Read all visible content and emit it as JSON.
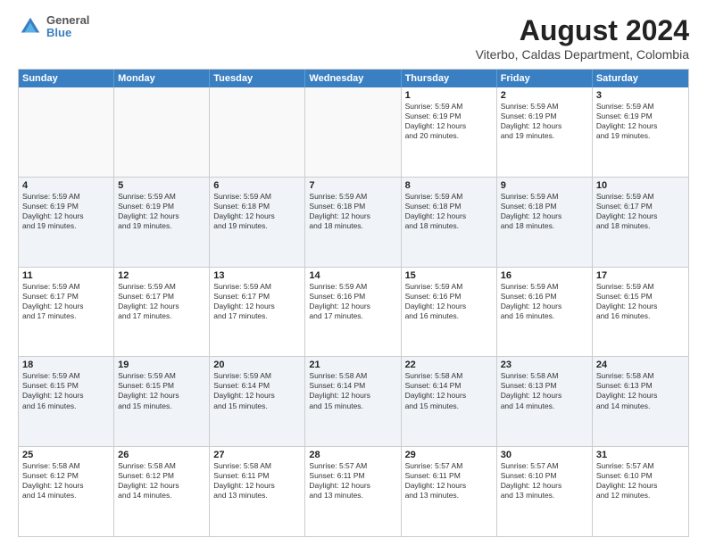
{
  "header": {
    "logo_line1": "General",
    "logo_line2": "Blue",
    "title": "August 2024",
    "subtitle": "Viterbo, Caldas Department, Colombia"
  },
  "days_of_week": [
    "Sunday",
    "Monday",
    "Tuesday",
    "Wednesday",
    "Thursday",
    "Friday",
    "Saturday"
  ],
  "weeks": [
    [
      {
        "day": "",
        "text": "",
        "empty": true
      },
      {
        "day": "",
        "text": "",
        "empty": true
      },
      {
        "day": "",
        "text": "",
        "empty": true
      },
      {
        "day": "",
        "text": "",
        "empty": true
      },
      {
        "day": "1",
        "text": "Sunrise: 5:59 AM\nSunset: 6:19 PM\nDaylight: 12 hours\nand 20 minutes."
      },
      {
        "day": "2",
        "text": "Sunrise: 5:59 AM\nSunset: 6:19 PM\nDaylight: 12 hours\nand 19 minutes."
      },
      {
        "day": "3",
        "text": "Sunrise: 5:59 AM\nSunset: 6:19 PM\nDaylight: 12 hours\nand 19 minutes."
      }
    ],
    [
      {
        "day": "4",
        "text": "Sunrise: 5:59 AM\nSunset: 6:19 PM\nDaylight: 12 hours\nand 19 minutes.",
        "shaded": true
      },
      {
        "day": "5",
        "text": "Sunrise: 5:59 AM\nSunset: 6:19 PM\nDaylight: 12 hours\nand 19 minutes.",
        "shaded": true
      },
      {
        "day": "6",
        "text": "Sunrise: 5:59 AM\nSunset: 6:18 PM\nDaylight: 12 hours\nand 19 minutes.",
        "shaded": true
      },
      {
        "day": "7",
        "text": "Sunrise: 5:59 AM\nSunset: 6:18 PM\nDaylight: 12 hours\nand 18 minutes.",
        "shaded": true
      },
      {
        "day": "8",
        "text": "Sunrise: 5:59 AM\nSunset: 6:18 PM\nDaylight: 12 hours\nand 18 minutes.",
        "shaded": true
      },
      {
        "day": "9",
        "text": "Sunrise: 5:59 AM\nSunset: 6:18 PM\nDaylight: 12 hours\nand 18 minutes.",
        "shaded": true
      },
      {
        "day": "10",
        "text": "Sunrise: 5:59 AM\nSunset: 6:17 PM\nDaylight: 12 hours\nand 18 minutes.",
        "shaded": true
      }
    ],
    [
      {
        "day": "11",
        "text": "Sunrise: 5:59 AM\nSunset: 6:17 PM\nDaylight: 12 hours\nand 17 minutes."
      },
      {
        "day": "12",
        "text": "Sunrise: 5:59 AM\nSunset: 6:17 PM\nDaylight: 12 hours\nand 17 minutes."
      },
      {
        "day": "13",
        "text": "Sunrise: 5:59 AM\nSunset: 6:17 PM\nDaylight: 12 hours\nand 17 minutes."
      },
      {
        "day": "14",
        "text": "Sunrise: 5:59 AM\nSunset: 6:16 PM\nDaylight: 12 hours\nand 17 minutes."
      },
      {
        "day": "15",
        "text": "Sunrise: 5:59 AM\nSunset: 6:16 PM\nDaylight: 12 hours\nand 16 minutes."
      },
      {
        "day": "16",
        "text": "Sunrise: 5:59 AM\nSunset: 6:16 PM\nDaylight: 12 hours\nand 16 minutes."
      },
      {
        "day": "17",
        "text": "Sunrise: 5:59 AM\nSunset: 6:15 PM\nDaylight: 12 hours\nand 16 minutes."
      }
    ],
    [
      {
        "day": "18",
        "text": "Sunrise: 5:59 AM\nSunset: 6:15 PM\nDaylight: 12 hours\nand 16 minutes.",
        "shaded": true
      },
      {
        "day": "19",
        "text": "Sunrise: 5:59 AM\nSunset: 6:15 PM\nDaylight: 12 hours\nand 15 minutes.",
        "shaded": true
      },
      {
        "day": "20",
        "text": "Sunrise: 5:59 AM\nSunset: 6:14 PM\nDaylight: 12 hours\nand 15 minutes.",
        "shaded": true
      },
      {
        "day": "21",
        "text": "Sunrise: 5:58 AM\nSunset: 6:14 PM\nDaylight: 12 hours\nand 15 minutes.",
        "shaded": true
      },
      {
        "day": "22",
        "text": "Sunrise: 5:58 AM\nSunset: 6:14 PM\nDaylight: 12 hours\nand 15 minutes.",
        "shaded": true
      },
      {
        "day": "23",
        "text": "Sunrise: 5:58 AM\nSunset: 6:13 PM\nDaylight: 12 hours\nand 14 minutes.",
        "shaded": true
      },
      {
        "day": "24",
        "text": "Sunrise: 5:58 AM\nSunset: 6:13 PM\nDaylight: 12 hours\nand 14 minutes.",
        "shaded": true
      }
    ],
    [
      {
        "day": "25",
        "text": "Sunrise: 5:58 AM\nSunset: 6:12 PM\nDaylight: 12 hours\nand 14 minutes."
      },
      {
        "day": "26",
        "text": "Sunrise: 5:58 AM\nSunset: 6:12 PM\nDaylight: 12 hours\nand 14 minutes."
      },
      {
        "day": "27",
        "text": "Sunrise: 5:58 AM\nSunset: 6:11 PM\nDaylight: 12 hours\nand 13 minutes."
      },
      {
        "day": "28",
        "text": "Sunrise: 5:57 AM\nSunset: 6:11 PM\nDaylight: 12 hours\nand 13 minutes."
      },
      {
        "day": "29",
        "text": "Sunrise: 5:57 AM\nSunset: 6:11 PM\nDaylight: 12 hours\nand 13 minutes."
      },
      {
        "day": "30",
        "text": "Sunrise: 5:57 AM\nSunset: 6:10 PM\nDaylight: 12 hours\nand 13 minutes."
      },
      {
        "day": "31",
        "text": "Sunrise: 5:57 AM\nSunset: 6:10 PM\nDaylight: 12 hours\nand 12 minutes."
      }
    ]
  ]
}
